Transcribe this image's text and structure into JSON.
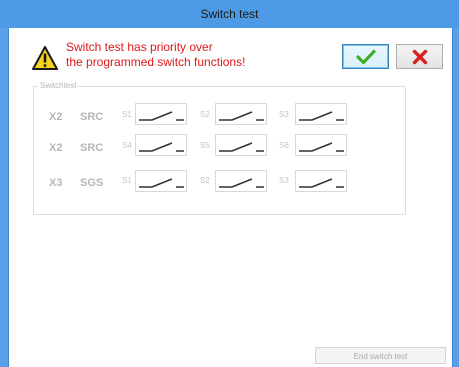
{
  "window": {
    "title": "Switch test"
  },
  "warning": {
    "line1": "Switch test has priority over",
    "line2": "the programmed switch functions!"
  },
  "colors": {
    "warning_text": "#e01818",
    "ok_check": "#3fae2a",
    "cancel_x": "#d92020"
  },
  "buttons": {
    "ok_icon": "checkmark-icon",
    "cancel_icon": "red-x-icon"
  },
  "group": {
    "label": "Switchtest",
    "rows": [
      {
        "port": "X2",
        "type": "SRC",
        "switches": [
          "S1",
          "S2",
          "S3"
        ]
      },
      {
        "port": "X2",
        "type": "SRC",
        "switches": [
          "S4",
          "S5",
          "S6"
        ]
      },
      {
        "port": "X3",
        "type": "SGS",
        "switches": [
          "S1",
          "S2",
          "S3"
        ]
      }
    ]
  },
  "footer": {
    "end_label": "End switch test"
  }
}
